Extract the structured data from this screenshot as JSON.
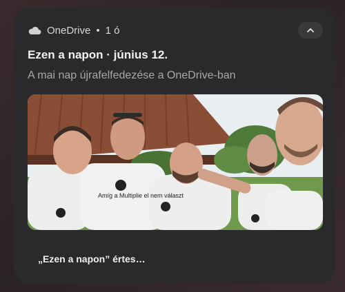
{
  "notification": {
    "app_name": "OneDrive",
    "separator": "•",
    "time": "1 ó",
    "title": "Ezen a napon · június 12.",
    "subtitle": "A mai nap újrafelfedezése a OneDrive-ban",
    "action_label": "„Ezen a napon” értes…",
    "photo_shirt_text": "Amíg a Multiplie el nem választ",
    "icons": {
      "app": "cloud-icon",
      "collapse": "chevron-up-icon"
    },
    "colors": {
      "card": "#2a2a2c",
      "background": "#2d2528",
      "title": "#f2f2f4",
      "subtitle": "#a9a9ad"
    }
  }
}
